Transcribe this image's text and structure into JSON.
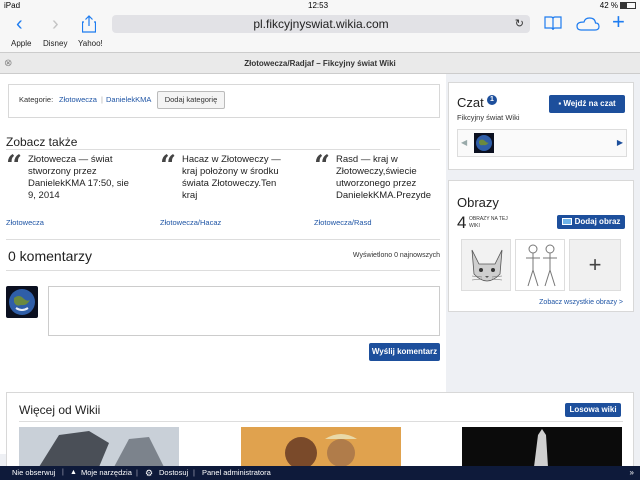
{
  "status": {
    "device": "iPad",
    "time": "12:53",
    "battery": "42 %"
  },
  "browser": {
    "url": "pl.fikcyjnyswiat.wikia.com",
    "bookmarks": [
      "Apple",
      "Disney",
      "Yahoo!"
    ],
    "tab_title": "Złotowecza/Radjaf – Fikcyjny świat Wiki"
  },
  "categories": {
    "label": "Kategorie:",
    "items": [
      "Złotowecza",
      "DanielekKMA"
    ],
    "add_button": "Dodaj kategorię"
  },
  "see_also": {
    "heading": "Zobacz także",
    "items": [
      {
        "quote": "Złotowecza — świat stworzony przez DanielekKMA 17:50, sie 9, 2014",
        "link": "Złotowecza"
      },
      {
        "quote": "Hacaz w Złotoweczy — kraj położony w środku świata Złotoweczy.Ten kraj",
        "link": "Złotowecza/Hacaz"
      },
      {
        "quote": "Rasd — kraj w Złotoweczy,świecie utworzonego przez DanielekKMA.Prezyde",
        "link": "Złotowecza/Rasd"
      }
    ]
  },
  "comments": {
    "heading": "0 komentarzy",
    "shown": "Wyświetlono 0 najnowszych",
    "submit": "Wyślij komentarz",
    "placeholder": ""
  },
  "more": {
    "heading": "Więcej od Wikii",
    "random_button": "Losowa wiki"
  },
  "chat": {
    "title": "Czat",
    "badge": "1",
    "join_button": "Wejdź na czat",
    "wiki_name": "Fikcyjny świat Wiki"
  },
  "images": {
    "title": "Obrazy",
    "count": "4",
    "count_label": "OBRAZY NA TEJ WIKI",
    "add_button": "Dodaj obraz",
    "add_tile": "+",
    "see_all": "Zobacz wszystkie obrazy >"
  },
  "footer": {
    "items": [
      "Nie obserwuj",
      "Moje narzędzia",
      "Dostosuj",
      "Panel administratora"
    ]
  },
  "colors": {
    "accent": "#1d4f9c",
    "link": "#1f55a5",
    "ios_blue": "#1e7cf0",
    "footer": "#0e1a3a"
  }
}
